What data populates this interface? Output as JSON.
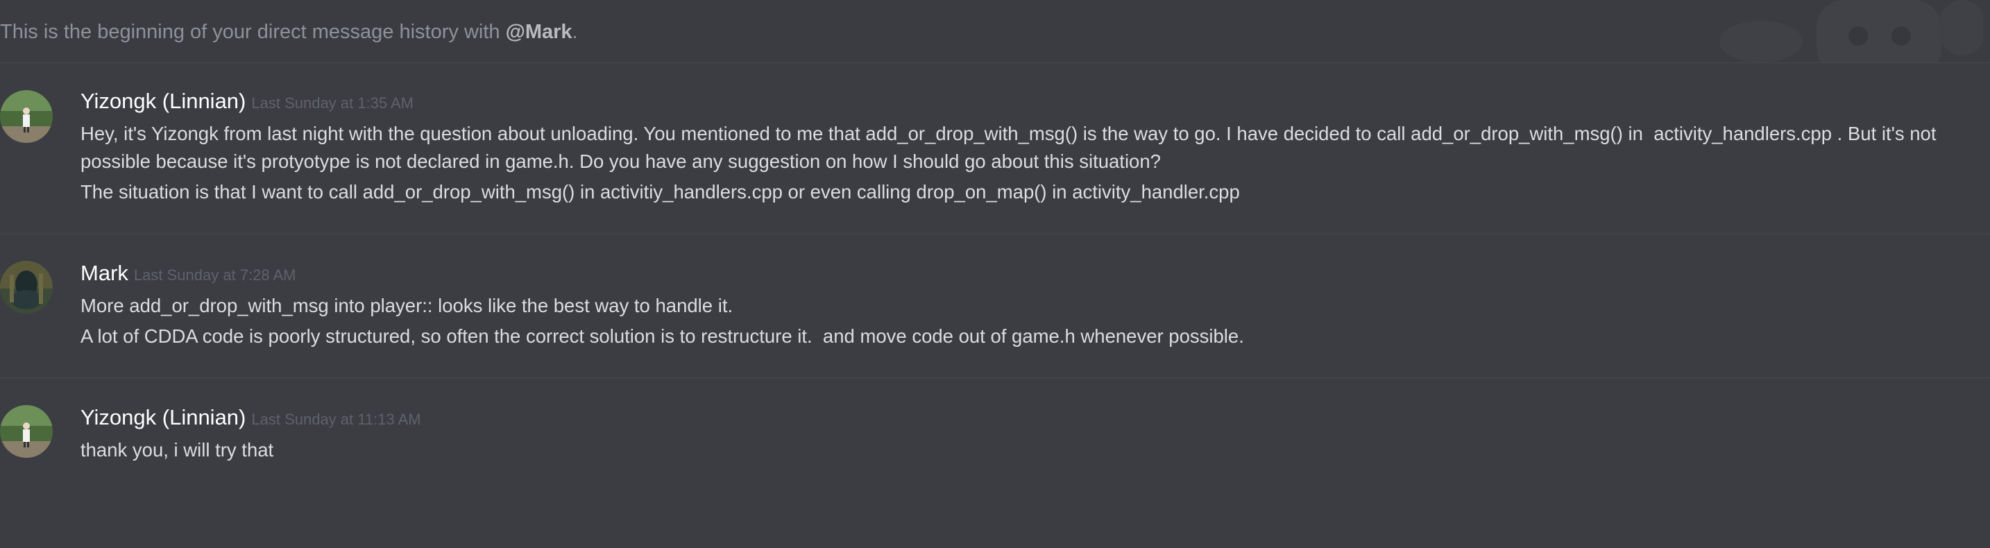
{
  "intro": {
    "prefix": "This is the beginning of your direct message history with ",
    "mention": "@Mark",
    "suffix": "."
  },
  "messages": [
    {
      "author": "Yizongk (Linnian)",
      "timestamp": "Last Sunday at 1:35 AM",
      "lines": [
        "Hey, it's Yizongk from last night with the question about unloading. You mentioned to me that add_or_drop_with_msg() is the way to go. I have decided to call add_or_drop_with_msg() in  activity_handlers.cpp . But it's not possible because it's protyotype is not declared in game.h. Do you have any suggestion on how I should go about this situation?",
        "The situation is that I want to call add_or_drop_with_msg() in activitiy_handlers.cpp or even calling drop_on_map() in activity_handler.cpp"
      ]
    },
    {
      "author": "Mark",
      "timestamp": "Last Sunday at 7:28 AM",
      "lines": [
        "More add_or_drop_with_msg into player:: looks like the best way to handle it.",
        "A lot of CDDA code is poorly structured, so often the correct solution is to restructure it.  and move code out of game.h whenever possible."
      ]
    },
    {
      "author": "Yizongk (Linnian)",
      "timestamp": "Last Sunday at 11:13 AM",
      "lines": [
        "thank you, i will try that"
      ]
    }
  ],
  "colors": {
    "background": "#3b3d43",
    "username": "#ffffff",
    "timestamp": "#5f6268",
    "message_text": "#dcddde",
    "intro_text": "#8e9297"
  }
}
